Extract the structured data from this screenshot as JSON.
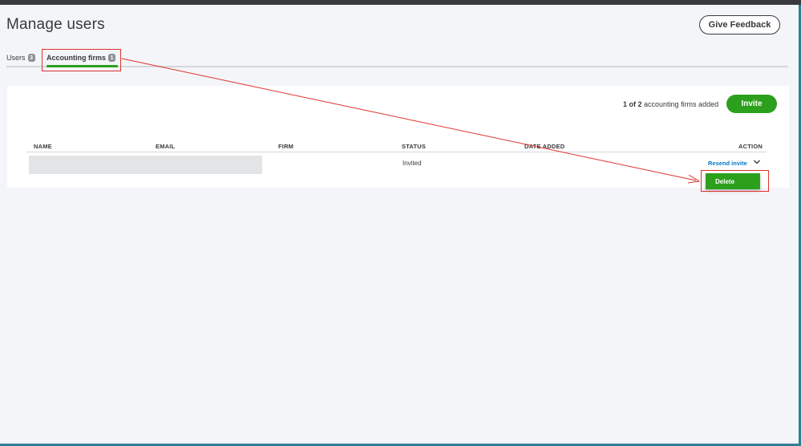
{
  "header": {
    "title": "Manage users",
    "feedback_label": "Give Feedback"
  },
  "tabs": [
    {
      "label": "Users",
      "count": "3"
    },
    {
      "label": "Accounting firms",
      "count": "1"
    }
  ],
  "summary": {
    "count": "1 of 2",
    "suffix": "accounting firms added"
  },
  "invite_label": "Invite",
  "table": {
    "columns": [
      "NAME",
      "EMAIL",
      "FIRM",
      "STATUS",
      "DATE ADDED",
      "ACTION"
    ],
    "rows": [
      {
        "name": "",
        "email": "",
        "firm": "",
        "status": "Invited",
        "date_added": "",
        "action": "Resend invite"
      }
    ]
  },
  "dropdown": {
    "items": [
      "Delete"
    ]
  },
  "colors": {
    "brand_green": "#2ca01c",
    "link_blue": "#0077c5",
    "annotation_red": "#e0312f"
  }
}
